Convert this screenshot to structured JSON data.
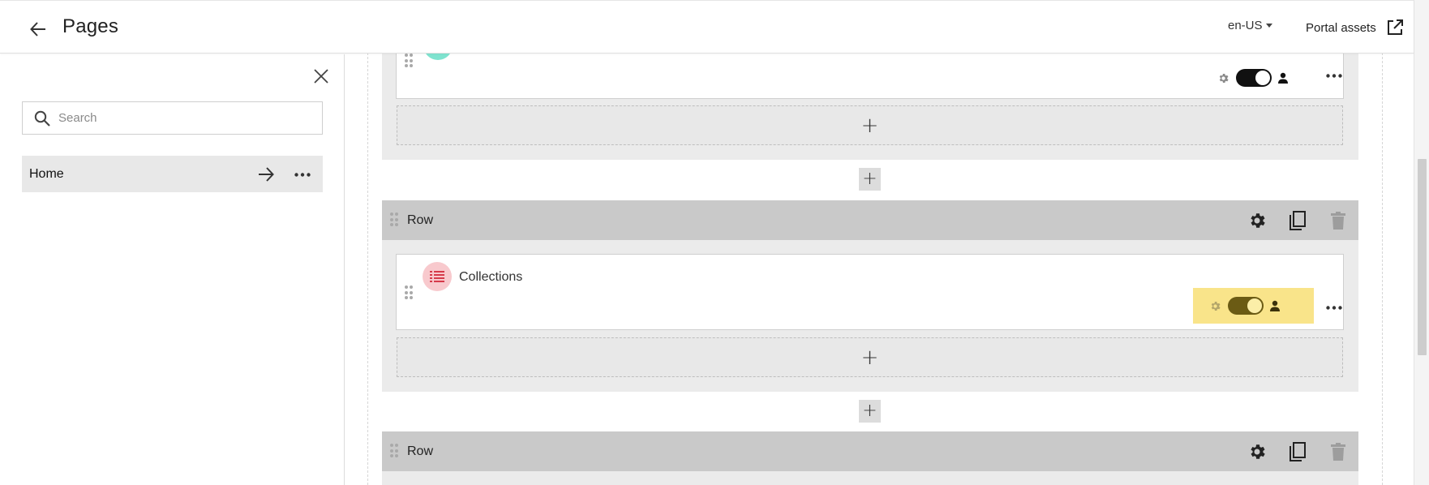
{
  "header": {
    "title": "Pages",
    "locale": "en-US",
    "portal_assets_label": "Portal assets"
  },
  "sidebar": {
    "search_placeholder": "Search",
    "search_value": "",
    "pages": [
      {
        "label": "Home"
      }
    ]
  },
  "canvas": {
    "rows": [
      {
        "label": "",
        "components": [
          {
            "label": "",
            "icon": "component-icon",
            "icon_color": "#7fe3cf",
            "visible": true
          }
        ]
      },
      {
        "label": "Row",
        "components": [
          {
            "label": "Collections",
            "icon": "list-icon",
            "icon_color": "#f8c9cd",
            "visible": true,
            "highlighted": true
          }
        ]
      },
      {
        "label": "Row",
        "components": []
      }
    ],
    "add_symbol": "+"
  },
  "colors": {
    "row_header": "#c9c9c9",
    "section_bg": "#ebebeb",
    "highlight": "#f9e48a",
    "toggle_on": "#111111",
    "toggle_on_highlighted": "#6b5b14",
    "collections_icon_fg": "#d63a4a"
  }
}
